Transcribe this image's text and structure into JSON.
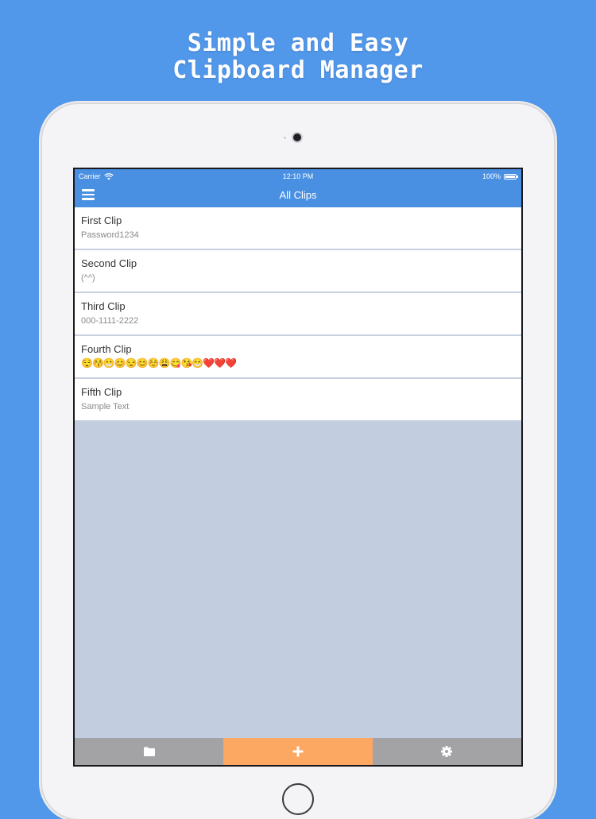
{
  "headline": {
    "line1": "Simple and Easy",
    "line2": "Clipboard Manager"
  },
  "status_bar": {
    "carrier": "Carrier",
    "time": "12:10 PM",
    "battery": "100%"
  },
  "nav": {
    "title": "All Clips"
  },
  "clips": [
    {
      "title": "First Clip",
      "body": "Password1234"
    },
    {
      "title": "Second Clip",
      "body": "(^^)"
    },
    {
      "title": "Third Clip",
      "body": "000-1111-2222"
    },
    {
      "title": "Fourth Clip",
      "body": "😌😚😁😊😒😊☺️😩😋😘😁❤️❤️❤️"
    },
    {
      "title": "Fifth Clip",
      "body": "Sample Text"
    }
  ],
  "tabs": [
    {
      "icon": "folder-icon"
    },
    {
      "icon": "plus-icon"
    },
    {
      "icon": "gear-icon"
    }
  ],
  "colors": {
    "background": "#5197ea",
    "nav_bar": "#4a90e2",
    "add_tab": "#fca762",
    "tab": "#a3a3a5",
    "list_empty": "#c2cddf"
  }
}
